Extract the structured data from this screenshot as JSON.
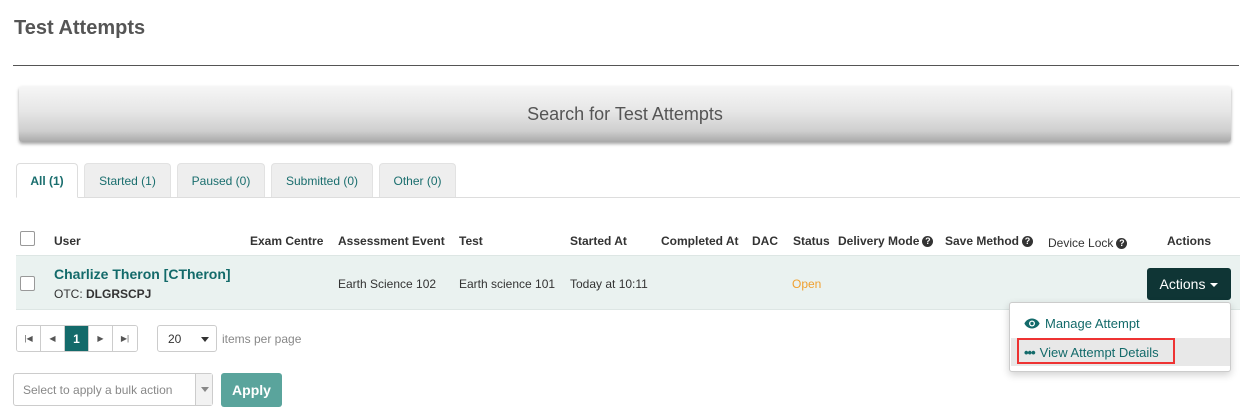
{
  "page": {
    "title": "Test Attempts"
  },
  "search": {
    "label": "Search for Test Attempts"
  },
  "tabs": [
    {
      "label": "All (1)",
      "active": true
    },
    {
      "label": "Started (1)",
      "active": false
    },
    {
      "label": "Paused (0)",
      "active": false
    },
    {
      "label": "Submitted (0)",
      "active": false
    },
    {
      "label": "Other (0)",
      "active": false
    }
  ],
  "table": {
    "columns": {
      "user": "User",
      "exam_centre": "Exam Centre",
      "assessment_event": "Assessment Event",
      "test": "Test",
      "started_at": "Started At",
      "completed_at": "Completed At",
      "dac": "DAC",
      "status": "Status",
      "delivery_mode": "Delivery Mode",
      "save_method": "Save Method",
      "device_lock": "Device Lock",
      "actions": "Actions"
    },
    "rows": [
      {
        "user": "Charlize Theron [CTheron]",
        "otc_label": "OTC:",
        "otc_value": "DLGRSCPJ",
        "exam_centre": "",
        "assessment_event": "Earth Science 102",
        "test": "Earth science 101",
        "started_at": "Today at 10:11",
        "completed_at": "",
        "dac": "",
        "status": "Open",
        "actions_label": "Actions"
      }
    ]
  },
  "actions_menu": {
    "items": [
      {
        "label": "Manage Attempt",
        "icon": "eye-icon"
      },
      {
        "label": "View Attempt Details",
        "icon": "ellipsis-icon"
      }
    ]
  },
  "pagination": {
    "first": "|◀",
    "prev": "◀",
    "current_page": "1",
    "next": "▶",
    "last": "▶|",
    "per_page": "20",
    "per_page_label": "items per page"
  },
  "bulk": {
    "placeholder": "Select to apply a bulk action",
    "apply_label": "Apply"
  },
  "colors": {
    "accent": "#136a6a",
    "actions_button": "#0f3535",
    "status_open": "#f0a030",
    "apply_button": "#5aa49c",
    "row_highlight": "#eaf2f0",
    "focus_outline": "#e33333"
  }
}
